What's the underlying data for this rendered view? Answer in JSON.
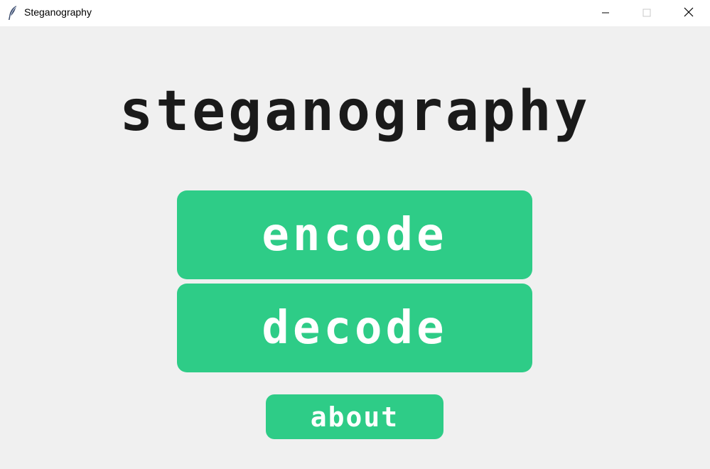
{
  "window": {
    "title": "Steganography",
    "app_icon": "feather-icon",
    "controls": {
      "minimize_icon": "minimize-icon",
      "maximize_icon": "maximize-icon",
      "close_icon": "close-icon"
    }
  },
  "main": {
    "heading": "steganography",
    "buttons": {
      "encode_label": "encode",
      "decode_label": "decode",
      "about_label": "about"
    }
  },
  "colors": {
    "background": "#f0f0f0",
    "accent": "#2ecc87",
    "heading_text": "#1a1a1a",
    "button_text": "#ffffff"
  }
}
